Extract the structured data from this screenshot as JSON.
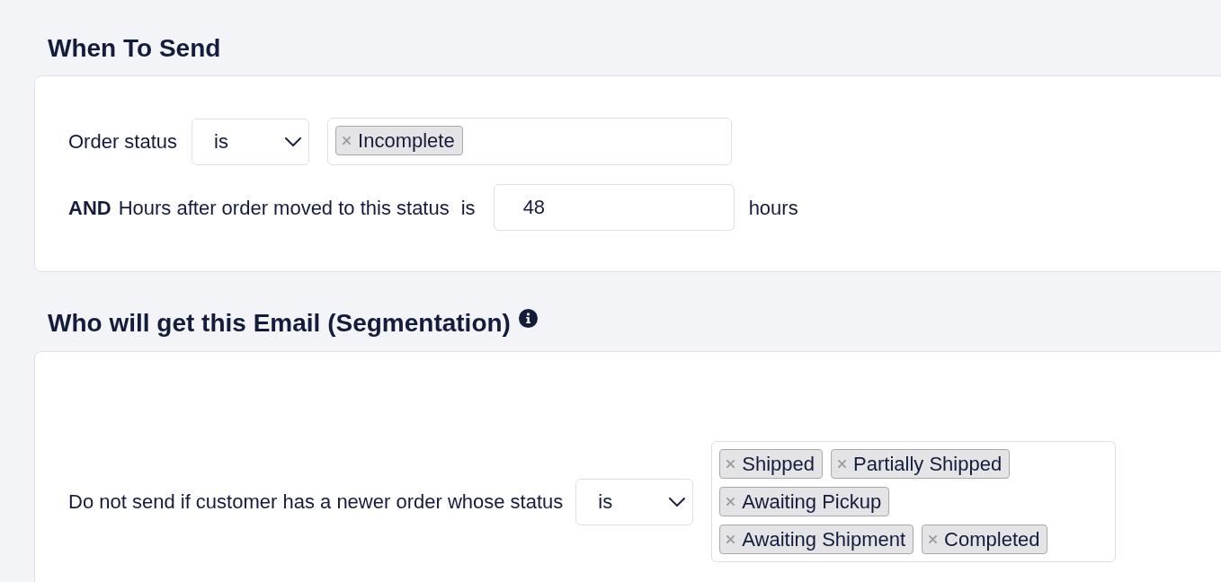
{
  "when_to_send": {
    "title": "When To Send",
    "order_status": {
      "label": "Order status",
      "operator": "is",
      "tags": [
        "Incomplete"
      ]
    },
    "hours_condition": {
      "conjunction": "AND",
      "label": "Hours after order moved to this status",
      "operator": "is",
      "value": "48",
      "unit": "hours"
    }
  },
  "segmentation": {
    "title": "Who will get this Email (Segmentation)",
    "newer_order_rule": {
      "label": "Do not send if customer has a newer order whose status",
      "operator": "is",
      "tags": [
        "Shipped",
        "Partially Shipped",
        "Awaiting Pickup",
        "Awaiting Shipment",
        "Completed"
      ]
    }
  }
}
